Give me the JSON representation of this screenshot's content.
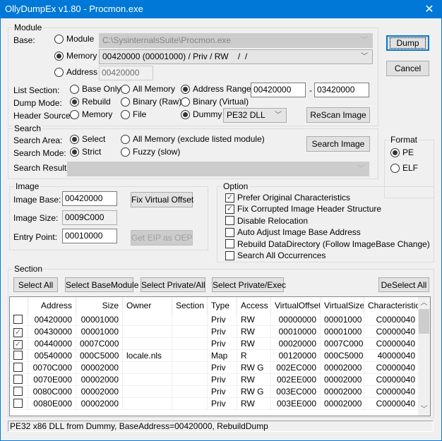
{
  "window": {
    "title": "OllyDumpEx v1.80 - Procmon.exe",
    "close_glyph": "✕"
  },
  "buttons": {
    "dump": "Dump",
    "cancel": "Cancel"
  },
  "module": {
    "group_label": "Module",
    "base_label": "Base:",
    "base_options": [
      {
        "label": "Module",
        "selected": false
      },
      {
        "label": "Memory",
        "selected": true
      },
      {
        "label": "Address",
        "selected": false
      }
    ],
    "module_path": "C:\\SysinternalsSuite\\Procmon.exe",
    "memory_value": "00420000 (00001000) / Priv / RW    /  /",
    "address_value": "00420000",
    "list_section": {
      "label": "List Section:",
      "options": [
        {
          "label": "Base Only",
          "selected": false
        },
        {
          "label": "All Memory",
          "selected": false
        },
        {
          "label": "Address Range",
          "selected": true
        }
      ],
      "range_start": "00420000",
      "range_sep": "-",
      "range_end": "03420000"
    },
    "dump_mode": {
      "label": "Dump Mode:",
      "options": [
        {
          "label": "Rebuild",
          "selected": true
        },
        {
          "label": "Binary (Raw)",
          "selected": false
        },
        {
          "label": "Binary (Virtual)",
          "selected": false
        }
      ]
    },
    "header_source": {
      "label": "Header Source:",
      "options": [
        {
          "label": "Memory",
          "selected": false
        },
        {
          "label": "File",
          "selected": false
        },
        {
          "label": "Dummy",
          "selected": true
        }
      ],
      "dummy_type": "PE32 DLL"
    },
    "rescan_button": "ReScan Image"
  },
  "search": {
    "group_label": "Search",
    "area": {
      "label": "Search Area:",
      "options": [
        {
          "label": "Select",
          "selected": true
        },
        {
          "label": "All Memory (exclude listed module)",
          "selected": false
        }
      ]
    },
    "mode": {
      "label": "Search Mode:",
      "options": [
        {
          "label": "Strict",
          "selected": true
        },
        {
          "label": "Fuzzy (slow)",
          "selected": false
        }
      ]
    },
    "result_label": "Search Result:",
    "result_value": "",
    "search_button": "Search Image"
  },
  "format": {
    "group_label": "Format",
    "options": [
      {
        "label": "PE",
        "selected": true
      },
      {
        "label": "ELF",
        "selected": false
      }
    ]
  },
  "image": {
    "group_label": "Image",
    "base_label": "Image Base:",
    "base_value": "00420000",
    "size_label": "Image Size:",
    "size_value": "0009C000",
    "entry_label": "Entry Point:",
    "entry_value": "00010000",
    "fix_button": "Fix Virtual Offset",
    "eip_button": "Get EIP as OEP"
  },
  "option": {
    "group_label": "Option",
    "items": [
      {
        "label": "Prefer Original Characteristics",
        "checked": true
      },
      {
        "label": "Fix Corrupted Image Header Structure",
        "checked": true
      },
      {
        "label": "Disable Relocation",
        "checked": false
      },
      {
        "label": "Auto Adjust Image Base Address",
        "checked": false
      },
      {
        "label": "Rebuild DataDirectory (Follow ImageBase Change)",
        "checked": false
      },
      {
        "label": "Search All Occurrences",
        "checked": false
      }
    ]
  },
  "section": {
    "group_label": "Section",
    "buttons": {
      "select_all": "Select All",
      "select_base": "Select BaseModule",
      "select_private_all": "Select Private/All",
      "select_private_exec": "Select Private/Exec",
      "deselect_all": "DeSelect All"
    },
    "columns": [
      "",
      "Address",
      "Size",
      "Owner",
      "Section",
      "Type",
      "Access",
      "VirtualOffset",
      "VirtualSize",
      "Characteristics"
    ],
    "rows": [
      {
        "checked": false,
        "address": "00420000",
        "size": "00001000",
        "owner": "",
        "section": "",
        "type": "Priv",
        "access": "RW",
        "voffset": "00000000",
        "vsize": "00001000",
        "chars": "C0000040"
      },
      {
        "checked": true,
        "address": "00430000",
        "size": "00001000",
        "owner": "",
        "section": "",
        "type": "Priv",
        "access": "RW",
        "voffset": "00010000",
        "vsize": "00001000",
        "chars": "C0000040"
      },
      {
        "checked": true,
        "address": "00440000",
        "size": "0007C000",
        "owner": "",
        "section": "",
        "type": "Priv",
        "access": "RW",
        "voffset": "00020000",
        "vsize": "0007C000",
        "chars": "C0000040"
      },
      {
        "checked": false,
        "address": "00540000",
        "size": "000C5000",
        "owner": "locale.nls",
        "section": "",
        "type": "Map",
        "access": "R",
        "voffset": "00120000",
        "vsize": "000C5000",
        "chars": "40000040"
      },
      {
        "checked": false,
        "address": "0070C000",
        "size": "00002000",
        "owner": "",
        "section": "",
        "type": "Priv",
        "access": "RW G",
        "voffset": "002EC000",
        "vsize": "00002000",
        "chars": "C0000040"
      },
      {
        "checked": false,
        "address": "0070E000",
        "size": "00002000",
        "owner": "",
        "section": "",
        "type": "Priv",
        "access": "RW",
        "voffset": "002EE000",
        "vsize": "00002000",
        "chars": "C0000040"
      },
      {
        "checked": false,
        "address": "0080C000",
        "size": "00002000",
        "owner": "",
        "section": "",
        "type": "Priv",
        "access": "RW G",
        "voffset": "003EC000",
        "vsize": "00002000",
        "chars": "C0000040"
      },
      {
        "checked": false,
        "address": "0080E000",
        "size": "00002000",
        "owner": "",
        "section": "",
        "type": "Priv",
        "access": "RW",
        "voffset": "003EE000",
        "vsize": "00002000",
        "chars": "C0000040"
      }
    ]
  },
  "status_text": "PE32 x86 DLL from Dummy, BaseAddress=00420000, RebuildDump"
}
